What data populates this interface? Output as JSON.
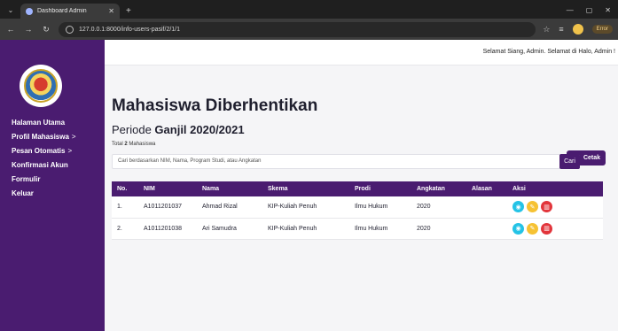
{
  "browser": {
    "tab_title": "Dashboard Admin",
    "url": "127.0.0.1:8000/info-users-pasif/2/1/1",
    "error_badge": "Error"
  },
  "sidebar": {
    "menu": [
      {
        "label": "Halaman Utama",
        "chevron": ""
      },
      {
        "label": "Profil Mahasiswa",
        "chevron": ">"
      },
      {
        "label": "Pesan Otomatis",
        "chevron": ">"
      },
      {
        "label": "Konfirmasi Akun",
        "chevron": ""
      },
      {
        "label": "Formulir",
        "chevron": ""
      },
      {
        "label": "Keluar",
        "chevron": ""
      }
    ]
  },
  "topbar": {
    "greeting": "Selamat Siang, Admin. Selamat di Halo, Admin !"
  },
  "page": {
    "title": "Mahasiswa Diberhentikan",
    "period_prefix": "Periode ",
    "period_value": "Ganjil 2020/2021",
    "total_prefix": "Total ",
    "total_count": "2",
    "total_suffix": " Mahasiswa",
    "print_label": "Cetak",
    "search_placeholder": "Cari berdasarkan NIM, Nama, Program Studi, atau Angkatan",
    "search_button": "Cari"
  },
  "table": {
    "columns": [
      "No.",
      "NIM",
      "Nama",
      "Skema",
      "Prodi",
      "Angkatan",
      "Alasan",
      "Aksi"
    ],
    "rows": [
      {
        "no": "1.",
        "nim": "A1011201037",
        "nama": "Ahmad Rizal",
        "skema": "KIP-Kuliah Penuh",
        "prodi": "Ilmu Hukum",
        "angkatan": "2020",
        "alasan": ""
      },
      {
        "no": "2.",
        "nim": "A1011201038",
        "nama": "Ari Samudra",
        "skema": "KIP-Kuliah Penuh",
        "prodi": "Ilmu Hukum",
        "angkatan": "2020",
        "alasan": ""
      }
    ]
  },
  "colors": {
    "primary": "#4a1c70",
    "view": "#24c3e6",
    "edit": "#f6c233",
    "delete": "#e2353b"
  }
}
